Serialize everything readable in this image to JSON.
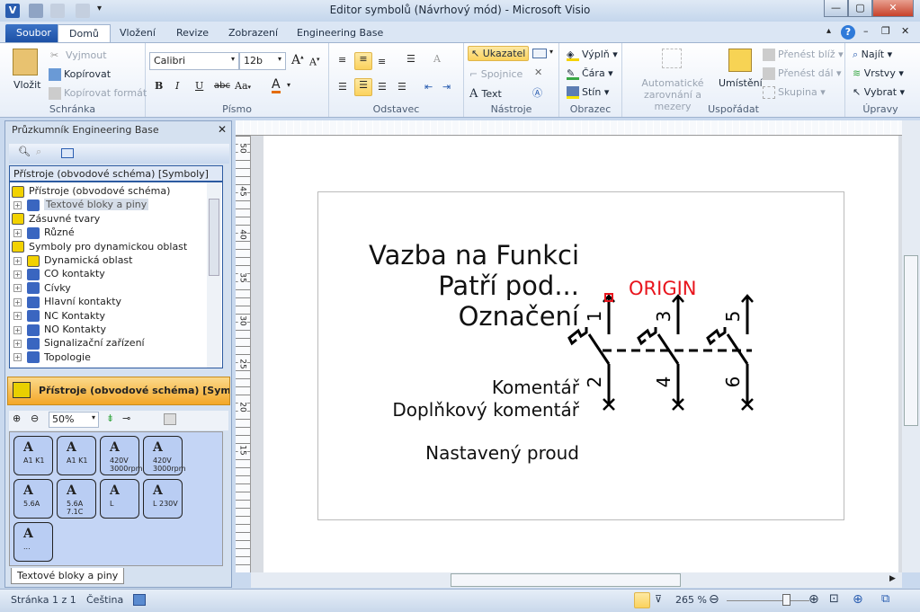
{
  "window": {
    "title": "Editor symbolů (Návrhový mód)  -  Microsoft Visio",
    "app_icon": "V",
    "minimize": "—",
    "maximize": "▢",
    "close": "✕"
  },
  "tabs": [
    {
      "label": "Soubor"
    },
    {
      "label": "Domů"
    },
    {
      "label": "Vložení"
    },
    {
      "label": "Revize"
    },
    {
      "label": "Zobrazení"
    },
    {
      "label": "Engineering Base"
    }
  ],
  "ribbon": {
    "clipboard": {
      "label": "Schránka",
      "paste": "Vložit",
      "cut": "Vyjmout",
      "copy": "Kopírovat",
      "format_painter": "Kopírovat formát"
    },
    "font": {
      "label": "Písmo",
      "family": "Calibri",
      "size": "12b",
      "bold": "B",
      "italic": "I",
      "underline": "U",
      "strike": "abc",
      "case": "Aa",
      "color": "A",
      "accent": "#e46c0a"
    },
    "paragraph": {
      "label": "Odstavec"
    },
    "tools": {
      "label": "Nástroje",
      "pointer": "Ukazatel",
      "connector": "Spojnice",
      "text": "Text"
    },
    "shape": {
      "label": "Obrazec",
      "fill": "Výplň",
      "line": "Čára",
      "shadow": "Stín"
    },
    "arrange": {
      "label": "Uspořádat",
      "auto_align": "Automatické zarovnání a mezery",
      "position": "Umístění",
      "bring_forward": "Přenést blíž",
      "send_backward": "Přenést dál",
      "group": "Skupina"
    },
    "editing": {
      "label": "Úpravy",
      "find": "Najít",
      "layers": "Vrstvy",
      "select": "Vybrat"
    }
  },
  "explorer": {
    "title": "Průzkumník Engineering Base",
    "header": "Přístroje (obvodové schéma) [Symboly]",
    "tree": [
      {
        "label": "Přístroje (obvodové schéma)",
        "level": 0,
        "icon": "folder-yellow"
      },
      {
        "label": "Textové bloky a piny",
        "level": 1,
        "icon": "symbol-group",
        "selected": true
      },
      {
        "label": "Zásuvné tvary",
        "level": 0,
        "icon": "plug"
      },
      {
        "label": "Různé",
        "level": 1,
        "icon": "symbol-group"
      },
      {
        "label": "Symboly pro dynamickou oblast",
        "level": 0,
        "icon": "folder-yellow"
      },
      {
        "label": "Dynamická oblast",
        "level": 1,
        "icon": "dynamic-area"
      },
      {
        "label": "CO kontakty",
        "level": 1,
        "icon": "symbol-group"
      },
      {
        "label": "Cívky",
        "level": 1,
        "icon": "symbol-group"
      },
      {
        "label": "Hlavní kontakty",
        "level": 1,
        "icon": "symbol-group"
      },
      {
        "label": "NC Kontakty",
        "level": 1,
        "icon": "symbol-group"
      },
      {
        "label": "NO Kontakty",
        "level": 1,
        "icon": "symbol-group"
      },
      {
        "label": "Signalizační zařízení",
        "level": 1,
        "icon": "symbol-group"
      },
      {
        "label": "Topologie",
        "level": 1,
        "icon": "symbol-group"
      }
    ],
    "stencil_title": "Přístroje (obvodové schéma) [Symbo...",
    "zoom": "50%",
    "stencil_tiles": [
      {
        "main": "A",
        "sub": "A1 K1"
      },
      {
        "main": "A",
        "sub": "A1 K1"
      },
      {
        "main": "A",
        "sub": "420V 3000rpm"
      },
      {
        "main": "A",
        "sub": "420V 3000rpm"
      },
      {
        "main": "A",
        "sub": "5.6A"
      },
      {
        "main": "A",
        "sub": "5.6A 7.1C"
      },
      {
        "main": "A",
        "sub": "L"
      },
      {
        "main": "A",
        "sub": "L 230V"
      },
      {
        "main": "A",
        "sub": "..."
      }
    ],
    "stencil_tab": "Textové bloky a piny"
  },
  "drawing": {
    "texts": [
      "Vazba na Funkci",
      "Patří pod...",
      "Označení",
      "Komentář",
      "Doplňkový komentář",
      "Nastavený proud"
    ],
    "origin": "ORIGIN",
    "origin_color": "#e8141c",
    "pins": [
      "1",
      "2",
      "3",
      "4",
      "5",
      "6"
    ],
    "ruler_v": [
      "50",
      "45",
      "40",
      "35",
      "30",
      "25",
      "20",
      "15"
    ]
  },
  "status": {
    "page": "Stránka 1 z 1",
    "language": "Čeština",
    "zoom": "265 %"
  }
}
